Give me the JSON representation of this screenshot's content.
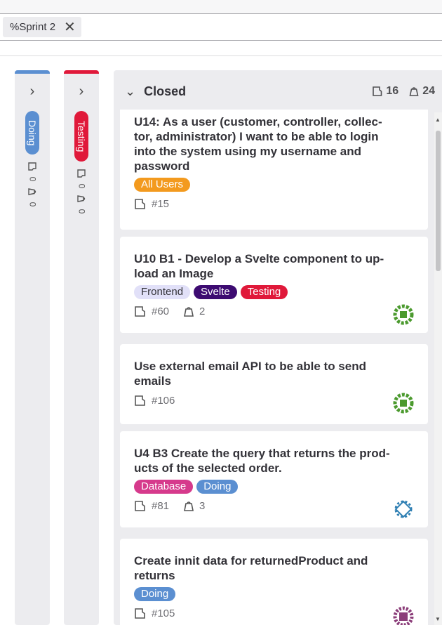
{
  "filter": {
    "token": "%Sprint 2",
    "remove_icon": "close-icon"
  },
  "columns": {
    "doing": {
      "label": "Doing",
      "color": "#5b8fd1",
      "issues": "0",
      "weight": "0"
    },
    "testing": {
      "label": "Testing",
      "color": "#e0193a",
      "issues": "0",
      "weight": "0"
    },
    "closed": {
      "title": "Closed",
      "issues": "16",
      "weight": "24"
    }
  },
  "cards": [
    {
      "title": "U14: As a user (customer, controller, collec-tor, administrator) I want to be able to login into the system using my username and password",
      "title_lines": [
        "U14: As a user (customer, controller, collec-",
        "tor, administrator) I want to be able to login",
        "into the system using my username and",
        "password"
      ],
      "labels": [
        {
          "text": "All Users",
          "color": "#f39a1e",
          "text_color": "#ffffff"
        }
      ],
      "id": "#15",
      "weight": null,
      "avatar": null
    },
    {
      "title_lines": [
        "U10 B1 - Develop a Svelte component to up-",
        "load an Image"
      ],
      "labels": [
        {
          "text": "Frontend",
          "color": "#e1e0f8",
          "text_color": "#333238"
        },
        {
          "text": "Svelte",
          "color": "#3d0b71",
          "text_color": "#ffffff"
        },
        {
          "text": "Testing",
          "color": "#e0193a",
          "text_color": "#ffffff"
        }
      ],
      "id": "#60",
      "weight": "2",
      "avatar": "green"
    },
    {
      "title_lines": [
        "Use external email API to be able to send",
        "emails"
      ],
      "labels": [],
      "id": "#106",
      "weight": null,
      "avatar": "green"
    },
    {
      "title_lines": [
        "U4 B3 Create the query that returns the prod-",
        "ucts of the selected order."
      ],
      "labels": [
        {
          "text": "Database",
          "color": "#d63a8c",
          "text_color": "#ffffff"
        },
        {
          "text": "Doing",
          "color": "#5b8fd1",
          "text_color": "#ffffff"
        }
      ],
      "id": "#81",
      "weight": "3",
      "avatar": "blue"
    },
    {
      "title_lines": [
        "Create innit data for returnedProduct and",
        "returns"
      ],
      "labels": [
        {
          "text": "Doing",
          "color": "#5b8fd1",
          "text_color": "#ffffff"
        }
      ],
      "id": "#105",
      "weight": null,
      "avatar": "purple"
    }
  ],
  "avatar_colors": {
    "green": "#4b9a2e",
    "blue": "#2f7fb3",
    "purple": "#8b3d79"
  }
}
